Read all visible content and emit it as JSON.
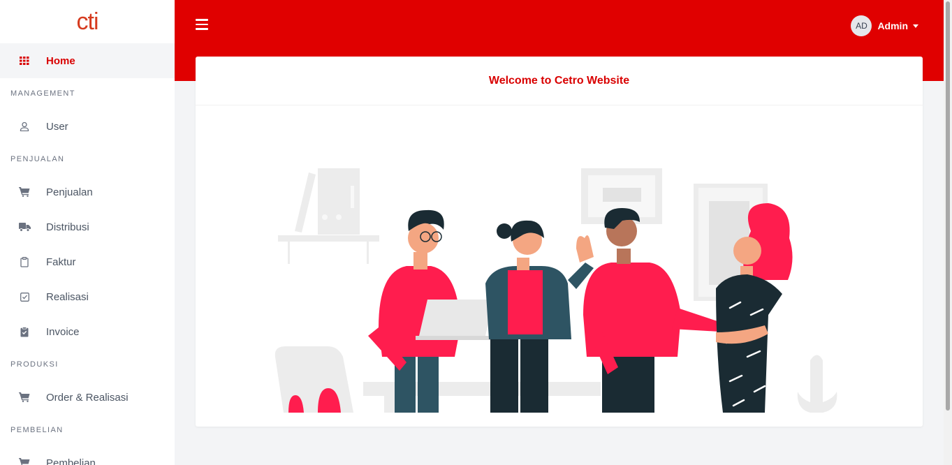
{
  "brand": {
    "logo_text": "cti"
  },
  "sidebar": {
    "home": {
      "label": "Home",
      "icon": "grid-icon"
    },
    "sections": [
      {
        "title": "MANAGEMENT",
        "items": [
          {
            "label": "User",
            "icon": "user-icon"
          }
        ]
      },
      {
        "title": "PENJUALAN",
        "items": [
          {
            "label": "Penjualan",
            "icon": "cart-icon"
          },
          {
            "label": "Distribusi",
            "icon": "truck-icon"
          },
          {
            "label": "Faktur",
            "icon": "clipboard-icon"
          },
          {
            "label": "Realisasi",
            "icon": "check-square-icon"
          },
          {
            "label": "Invoice",
            "icon": "clipboard-check-icon"
          }
        ]
      },
      {
        "title": "PRODUKSI",
        "items": [
          {
            "label": "Order & Realisasi",
            "icon": "cart-icon"
          }
        ]
      },
      {
        "title": "PEMBELIAN",
        "items": [
          {
            "label": "Pembelian",
            "icon": "cart-icon"
          }
        ]
      }
    ]
  },
  "header": {
    "user": {
      "initials": "AD",
      "name": "Admin"
    }
  },
  "main": {
    "card_title": "Welcome to Cetro Website"
  },
  "colors": {
    "brand_red": "#e00000",
    "accent_red": "#d90000",
    "logo_orange": "#d63b1f"
  }
}
